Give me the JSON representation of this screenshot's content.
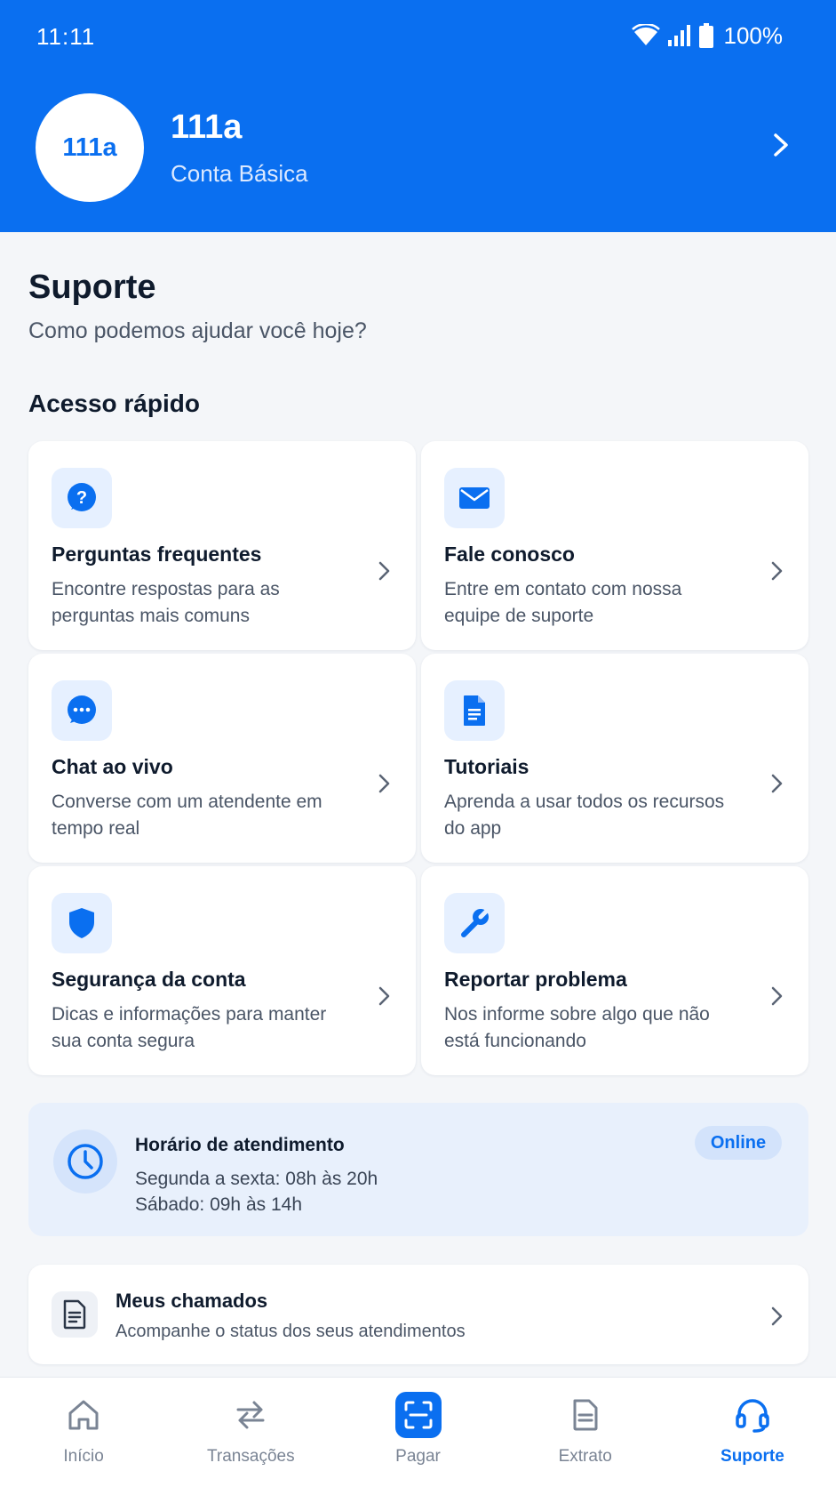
{
  "status_bar": {
    "time": "11:11",
    "battery": "100%"
  },
  "profile": {
    "avatar_text": "111a",
    "name": "111a",
    "plan": "Conta Básica"
  },
  "page": {
    "title": "Suporte",
    "subtitle": "Como podemos ajudar você hoje?",
    "section_title": "Acesso rápido"
  },
  "cards": [
    {
      "title": "Perguntas frequentes",
      "desc": "Encontre respostas para as perguntas mais comuns",
      "icon": "question-icon"
    },
    {
      "title": "Fale conosco",
      "desc": "Entre em contato com nossa equipe de suporte",
      "icon": "mail-icon"
    },
    {
      "title": "Chat ao vivo",
      "desc": "Converse com um atendente em tempo real",
      "icon": "chat-icon"
    },
    {
      "title": "Tutoriais",
      "desc": "Aprenda a usar todos os recursos do app",
      "icon": "document-icon"
    },
    {
      "title": "Segurança da conta",
      "desc": "Dicas e informações para manter sua conta segura",
      "icon": "shield-icon"
    },
    {
      "title": "Reportar problema",
      "desc": "Nos informe sobre algo que não está funcionando",
      "icon": "wrench-icon"
    }
  ],
  "hours": {
    "title": "Horário de atendimento",
    "line1": "Segunda a sexta: 08h às 20h",
    "line2": "Sábado: 09h às 14h",
    "badge": "Online"
  },
  "tickets": {
    "title": "Meus chamados",
    "desc": "Acompanhe o status dos seus atendimentos"
  },
  "nav": {
    "items": [
      {
        "label": "Início",
        "icon": "home-icon"
      },
      {
        "label": "Transações",
        "icon": "transfer-icon"
      },
      {
        "label": "Pagar",
        "icon": "scan-icon"
      },
      {
        "label": "Extrato",
        "icon": "statement-icon"
      },
      {
        "label": "Suporte",
        "icon": "headset-icon"
      }
    ],
    "active": "Suporte"
  },
  "colors": {
    "primary": "#0a6ff0",
    "background": "#f4f6f9",
    "icon_bg": "#e6f0ff"
  }
}
